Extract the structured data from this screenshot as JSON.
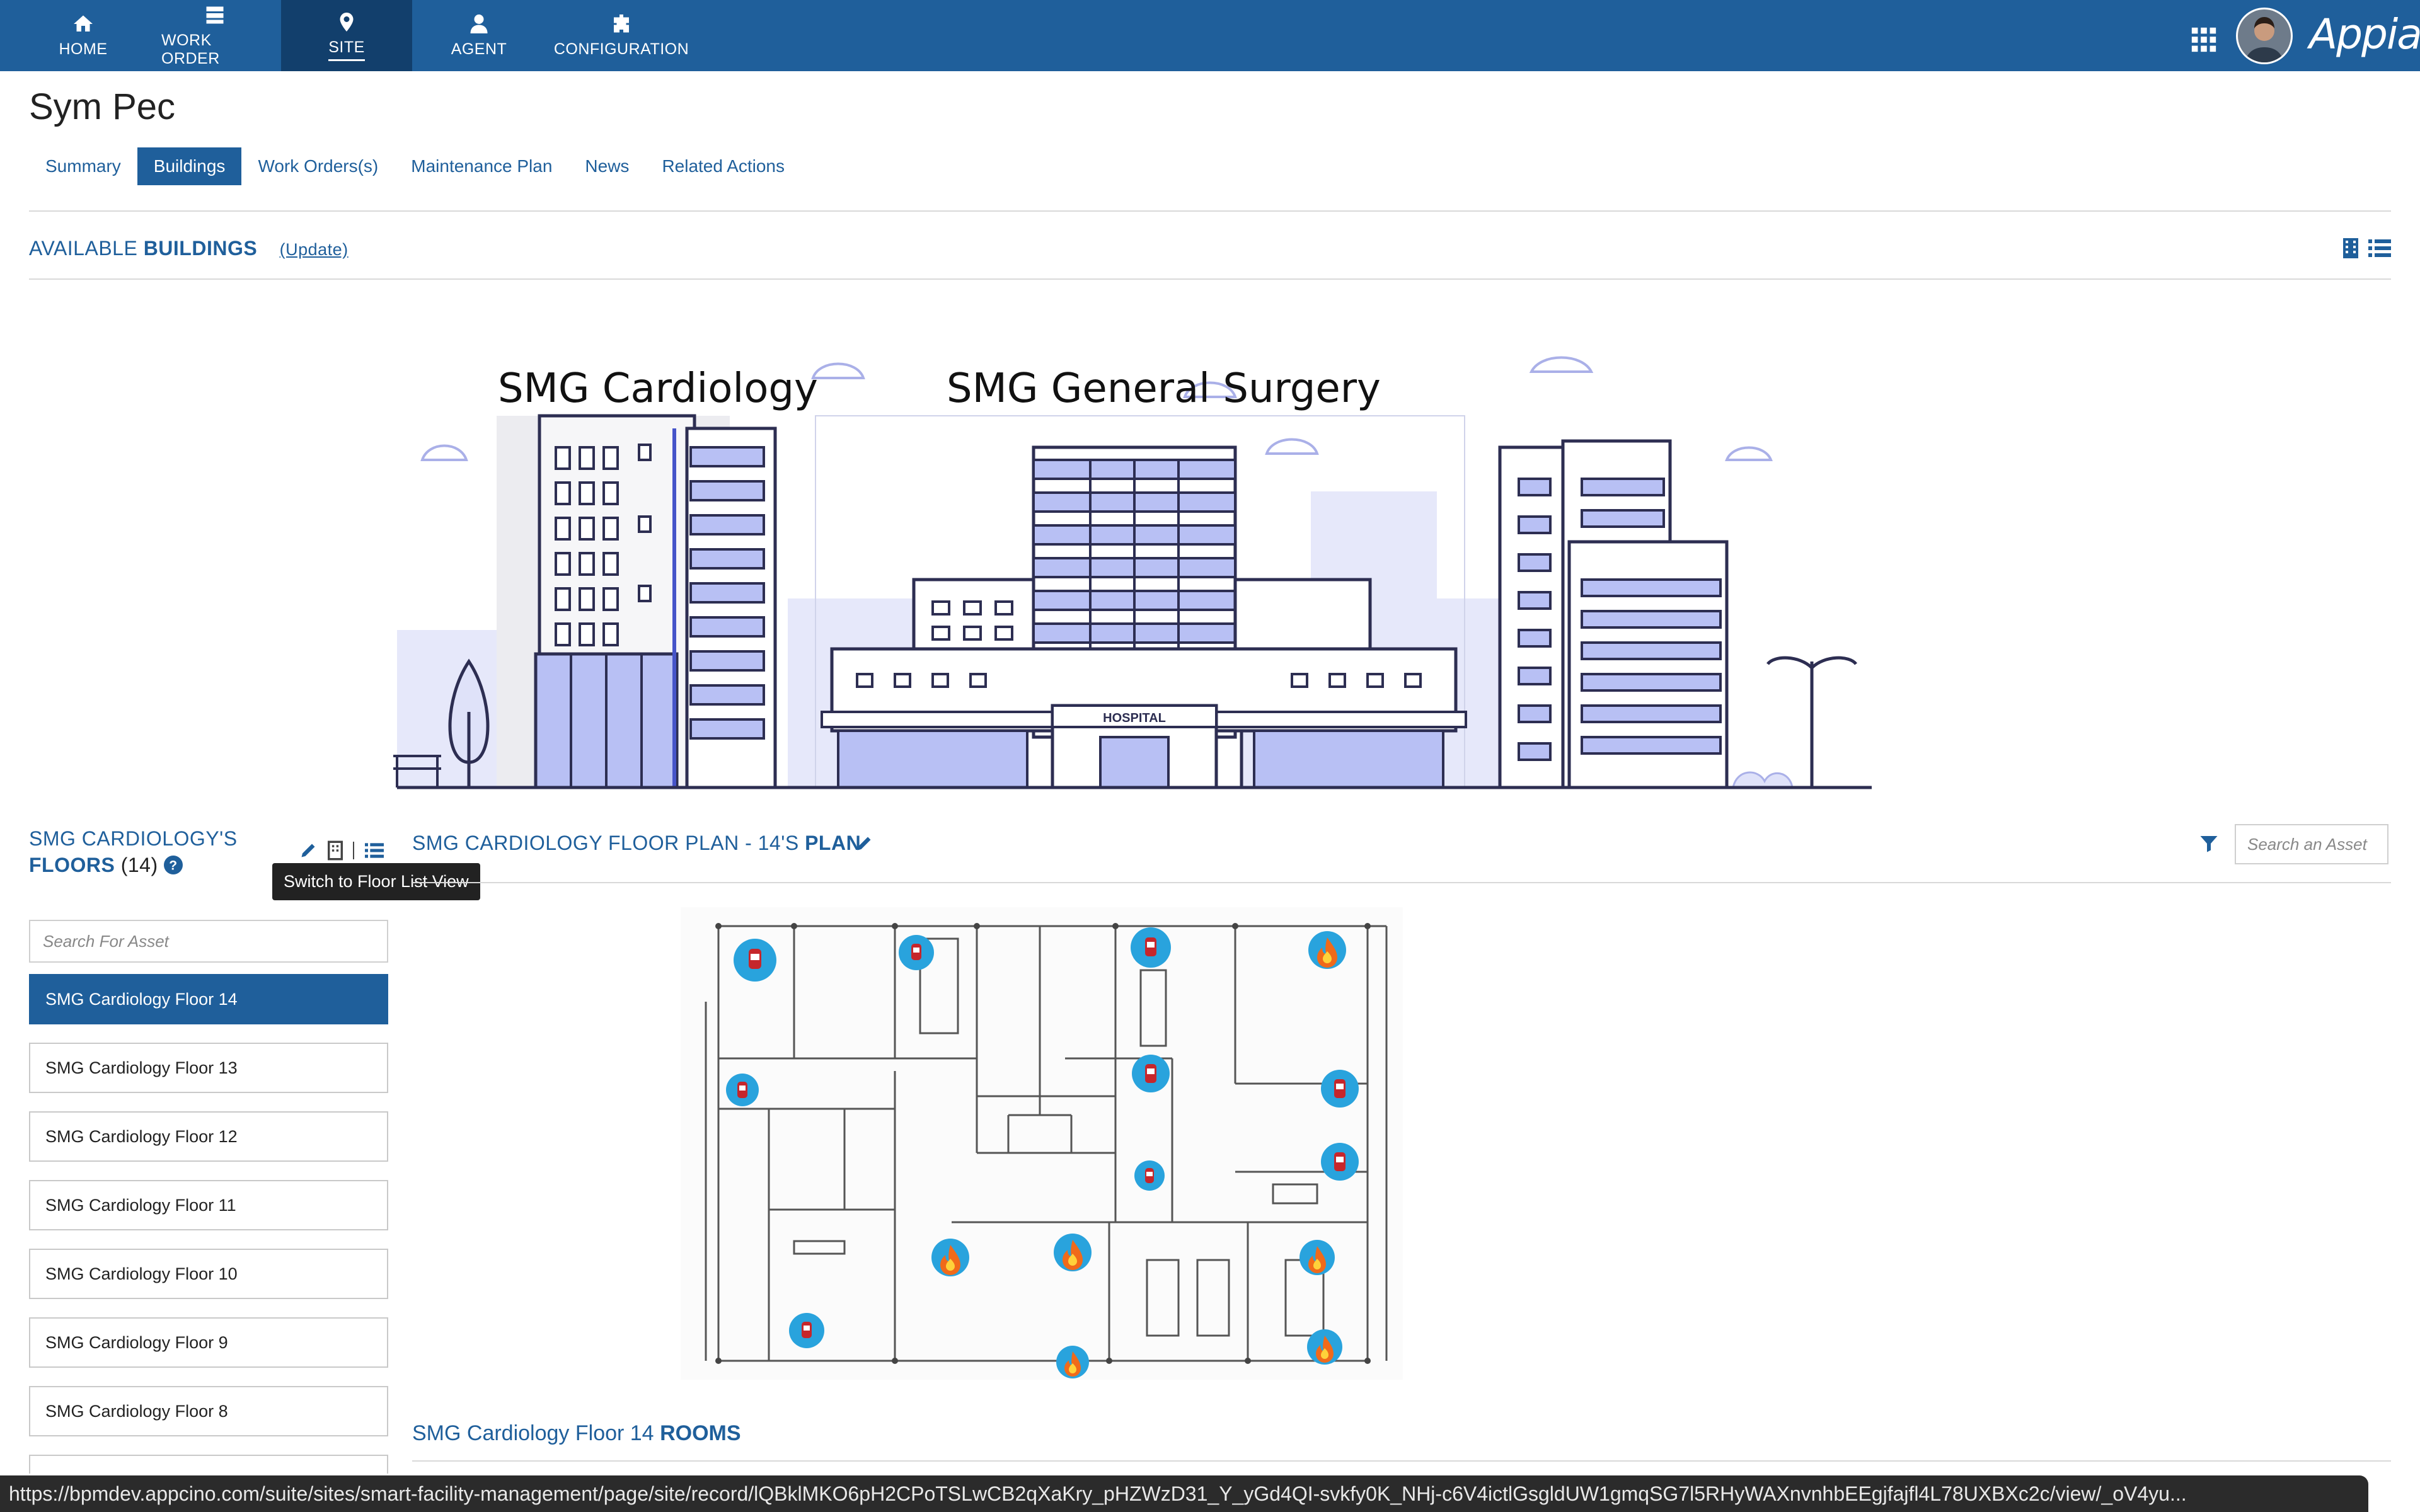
{
  "nav": {
    "items": [
      {
        "label": "HOME",
        "icon": "home-icon"
      },
      {
        "label": "WORK ORDER",
        "icon": "work-order-icon"
      },
      {
        "label": "SITE",
        "icon": "map-pin-icon"
      },
      {
        "label": "AGENT",
        "icon": "person-icon"
      },
      {
        "label": "CONFIGURATION",
        "icon": "puzzle-icon"
      }
    ],
    "active": "SITE",
    "brand": "Appian",
    "bg_color": "#1f5f9b",
    "active_bg_color": "#123f6c"
  },
  "page": {
    "title": "Sym Pec",
    "tabs": [
      "Summary",
      "Buildings",
      "Work Orders(s)",
      "Maintenance Plan",
      "News",
      "Related Actions"
    ],
    "active_tab": "Buildings"
  },
  "buildings": {
    "heading_prefix": "AVAILABLE",
    "heading_bold": "BUILDINGS",
    "update_link": "(Update)",
    "labels": [
      "SMG Cardiology",
      "SMG General Surgery"
    ],
    "hospital_sign": "HOSPITAL"
  },
  "floors": {
    "heading_line1": "SMG CARDIOLOGY'S",
    "heading_bold": "FLOORS",
    "count": "(14)",
    "tooltip": "Switch to Floor List View",
    "search_placeholder": "Search For Asset",
    "items": [
      "SMG Cardiology Floor 14",
      "SMG Cardiology Floor 13",
      "SMG Cardiology Floor 12",
      "SMG Cardiology Floor 11",
      "SMG Cardiology Floor 10",
      "SMG Cardiology Floor 9",
      "SMG Cardiology Floor 8"
    ],
    "selected": "SMG Cardiology Floor 14"
  },
  "plan": {
    "heading_prefix": "SMG CARDIOLOGY FLOOR PLAN - 14'S",
    "heading_bold": "PLAN",
    "asset_search_placeholder": "Search an Asset",
    "asset_markers": {
      "extinguisher_count": 10,
      "fire_count": 6
    }
  },
  "rooms": {
    "heading_prefix": "SMG Cardiology Floor 14",
    "heading_bold": "ROOMS"
  },
  "status_bar": {
    "url": "https://bpmdev.appcino.com/suite/sites/smart-facility-management/page/site/record/lQBklMKO6pH2CPoTSLwCB2qXaKry_pHZWzD31_Y_yGd4QI-svkfy0K_NHj-c6V4ictlGsgldUW1gmqSG7l5RHyWAXnvnhbEEgjfajfl4L78UXBXc2c/view/_oV4yu..."
  }
}
